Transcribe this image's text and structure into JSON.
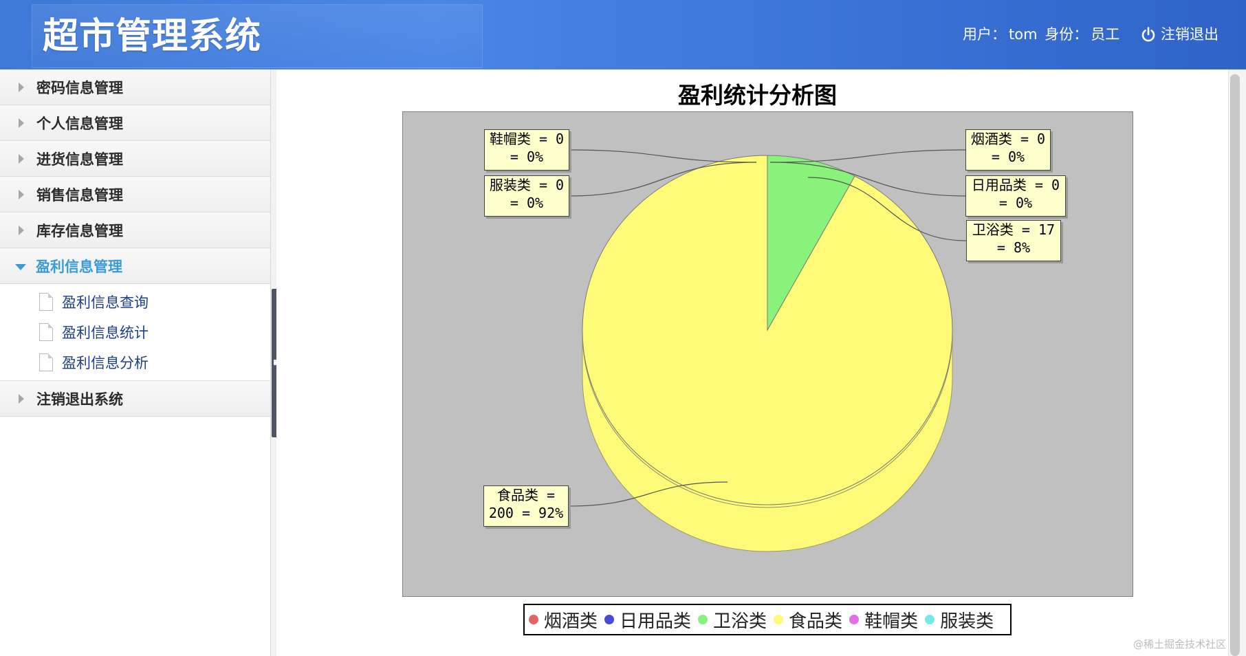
{
  "header": {
    "app_title": "超市管理系统",
    "user_label": "用户：",
    "user_name": "tom",
    "role_label": "身份：",
    "role_value": "员工",
    "logout_label": "注销退出"
  },
  "sidebar": {
    "items": [
      {
        "label": "密码信息管理"
      },
      {
        "label": "个人信息管理"
      },
      {
        "label": "进货信息管理"
      },
      {
        "label": "销售信息管理"
      },
      {
        "label": "库存信息管理"
      },
      {
        "label": "盈利信息管理",
        "expanded": true
      },
      {
        "label": "注销退出系统"
      }
    ],
    "subitems": [
      {
        "label": "盈利信息查询"
      },
      {
        "label": "盈利信息统计"
      },
      {
        "label": "盈利信息分析"
      }
    ]
  },
  "chart_data": {
    "type": "pie",
    "title": "盈利统计分析图",
    "style": "3d",
    "slices": [
      {
        "name": "烟酒类",
        "value": 0,
        "percent": "0%",
        "color": "#e06666"
      },
      {
        "name": "日用品类",
        "value": 0,
        "percent": "0%",
        "color": "#4a4ad6"
      },
      {
        "name": "卫浴类",
        "value": 17,
        "percent": "8%",
        "color": "#88f27a"
      },
      {
        "name": "食品类",
        "value": 200,
        "percent": "92%",
        "color": "#fffa78"
      },
      {
        "name": "鞋帽类",
        "value": 0,
        "percent": "0%",
        "color": "#e36ee8"
      },
      {
        "name": "服装类",
        "value": 0,
        "percent": "0%",
        "color": "#7ae8e8"
      }
    ],
    "labels": {
      "烟酒类": [
        "烟酒类 = 0",
        "= 0%"
      ],
      "日用品类": [
        "日用品类 = 0",
        "= 0%"
      ],
      "卫浴类": [
        "卫浴类 = 17",
        "= 8%"
      ],
      "食品类": [
        "食品类 =",
        "200 = 92%"
      ],
      "鞋帽类": [
        "鞋帽类 = 0",
        "= 0%"
      ],
      "服装类": [
        "服装类 = 0",
        "= 0%"
      ]
    },
    "legend_position": "bottom",
    "plot_background": "#c0c0c0"
  },
  "watermark": "@稀土掘金技术社区"
}
